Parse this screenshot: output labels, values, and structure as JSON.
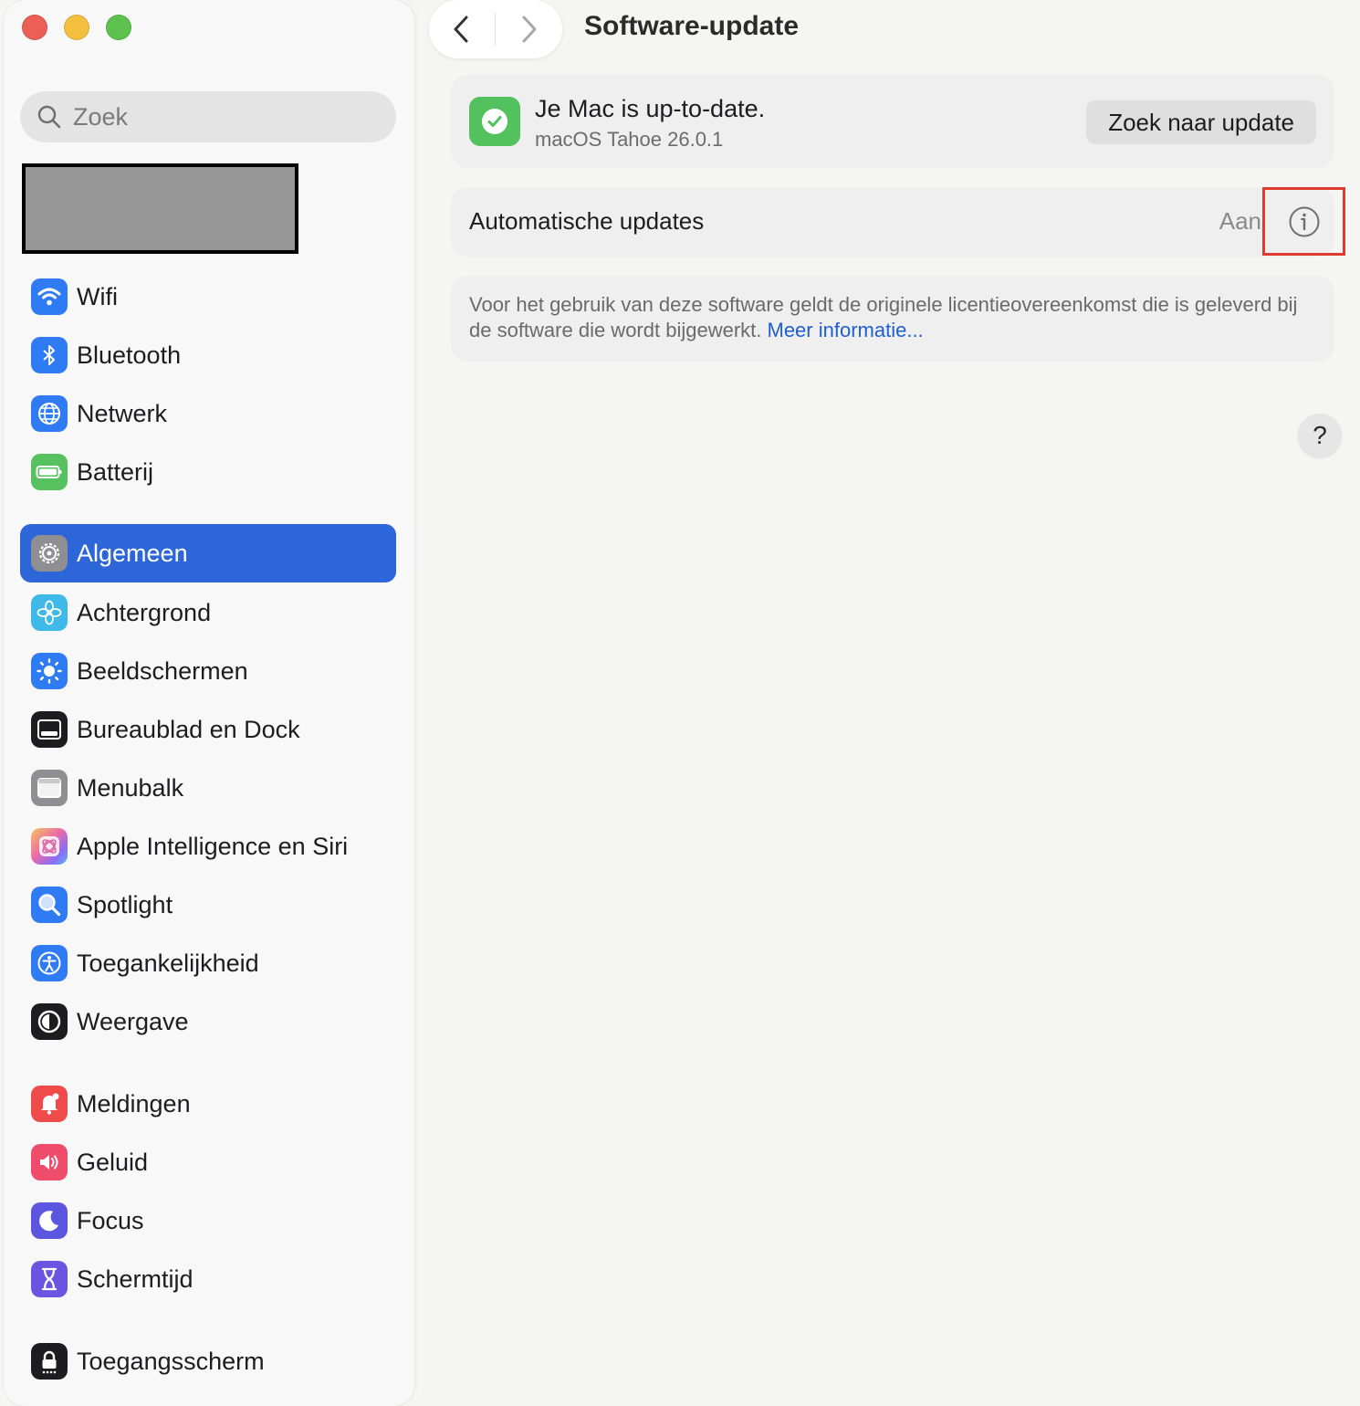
{
  "window": {
    "page_title": "Software-update",
    "traffic_lights": {
      "close": "#ec5f56",
      "minimize": "#f4bf3e",
      "zoom": "#5cc24d"
    }
  },
  "sidebar": {
    "search": {
      "placeholder": "Zoek",
      "value": ""
    },
    "items": [
      {
        "label": "Wifi",
        "icon": "wifi-icon",
        "color": "#2f7bf4"
      },
      {
        "label": "Bluetooth",
        "icon": "bluetooth-icon",
        "color": "#2f7bf4"
      },
      {
        "label": "Netwerk",
        "icon": "globe-icon",
        "color": "#2f7bf4"
      },
      {
        "label": "Batterij",
        "icon": "battery-icon",
        "color": "#56c15e"
      },
      {
        "label": "Algemeen",
        "icon": "gear-icon",
        "color": "#8e8e93",
        "selected": true
      },
      {
        "label": "Achtergrond",
        "icon": "flower-icon",
        "color": "#3fb9e8"
      },
      {
        "label": "Beeldschermen",
        "icon": "sun-icon",
        "color": "#2f7bf4"
      },
      {
        "label": "Bureaublad en Dock",
        "icon": "dock-icon",
        "color": "#1d1d1f"
      },
      {
        "label": "Menubalk",
        "icon": "menubar-icon",
        "color": "#8e8e93"
      },
      {
        "label": "Apple Intelligence en Siri",
        "icon": "apple-intelligence-icon",
        "color": "#e86fb3"
      },
      {
        "label": "Spotlight",
        "icon": "magnifier-icon",
        "color": "#2f7bf4"
      },
      {
        "label": "Toegankelijkheid",
        "icon": "accessibility-icon",
        "color": "#2f7bf4"
      },
      {
        "label": "Weergave",
        "icon": "appearance-icon",
        "color": "#1d1d1f"
      },
      {
        "label": "Meldingen",
        "icon": "bell-icon",
        "color": "#ef4b4b"
      },
      {
        "label": "Geluid",
        "icon": "speaker-icon",
        "color": "#ef4b6a"
      },
      {
        "label": "Focus",
        "icon": "moon-icon",
        "color": "#5b55e0"
      },
      {
        "label": "Schermtijd",
        "icon": "hourglass-icon",
        "color": "#6b55e0"
      },
      {
        "label": "Toegangsscherm",
        "icon": "lock-icon",
        "color": "#1d1d1f"
      }
    ]
  },
  "status": {
    "title": "Je Mac is up-to-date.",
    "version": "macOS Tahoe 26.0.1",
    "check_button": "Zoek naar update"
  },
  "auto_updates": {
    "label": "Automatische updates",
    "value": "Aan"
  },
  "license": {
    "text": "Voor het gebruik van deze software geldt de originele licentieovereenkomst die is geleverd bij de software die wordt bijgewerkt.",
    "link": "Meer informatie..."
  },
  "help": {
    "label": "?"
  },
  "accent": "#2c66d8",
  "highlight_color": "#e03a2e"
}
